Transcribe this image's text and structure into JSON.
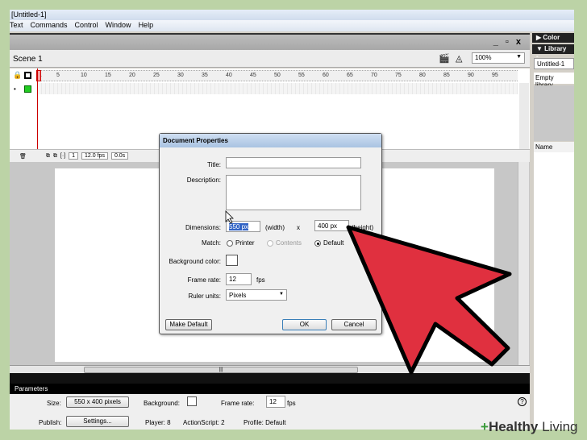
{
  "window": {
    "title": "[Untitled-1]"
  },
  "menu": [
    "Text",
    "Commands",
    "Control",
    "Window",
    "Help"
  ],
  "doc": {
    "win_buttons": "_ ▫ x",
    "scene": "Scene 1",
    "zoom": "100%"
  },
  "timeline": {
    "ruler": [
      "1",
      "5",
      "10",
      "15",
      "20",
      "25",
      "30",
      "35",
      "40",
      "45",
      "50",
      "55",
      "60",
      "65",
      "70",
      "75",
      "80",
      "85",
      "90",
      "95"
    ],
    "frame": "1",
    "fps": "12.0 fps",
    "time": "0.0s"
  },
  "stage": {
    "scroll_grip": "|||"
  },
  "right_panel": {
    "color": "▶ Color",
    "library": "▼ Library -",
    "library_select": "Untitled-1",
    "empty": "Empty library",
    "name_col": "Name"
  },
  "dialog": {
    "title": "Document Properties",
    "title_label": "Title:",
    "title_value": "",
    "description_label": "Description:",
    "dimensions_label": "Dimensions:",
    "width": "550 px",
    "width_suffix": "(width)",
    "x": "x",
    "height": "400 px",
    "height_suffix": "(height)",
    "match_label": "Match:",
    "match_options": [
      "Printer",
      "Contents",
      "Default"
    ],
    "bg_label": "Background color:",
    "frame_rate_label": "Frame rate:",
    "frame_rate": "12",
    "fps": "fps",
    "ruler_label": "Ruler units:",
    "ruler_value": "Pixels",
    "make_default": "Make Default",
    "ok": "OK",
    "cancel": "Cancel"
  },
  "properties": {
    "header": "Parameters",
    "size_label": "Size:",
    "size_value": "550 x 400 pixels",
    "background_label": "Background:",
    "frame_rate_label": "Frame rate:",
    "frame_rate": "12",
    "fps": "fps",
    "publish_label": "Publish:",
    "settings": "Settings...",
    "player": "Player: 8",
    "actionscript": "ActionScript: 2",
    "profile": "Profile: Default",
    "help": "?"
  },
  "watermark": {
    "bold": "Healthy",
    "light": "Living"
  },
  "colors": {
    "arrow": "#e0303f",
    "background": "#bcd3a6"
  }
}
